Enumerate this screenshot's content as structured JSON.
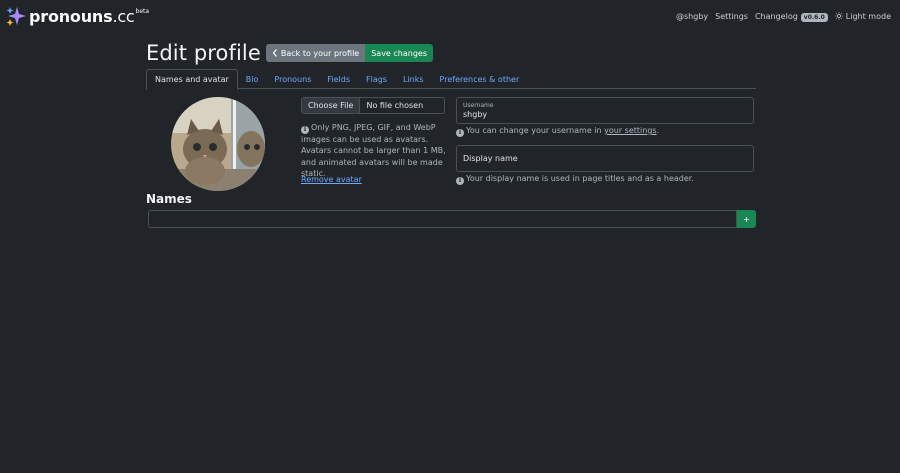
{
  "navbar": {
    "brand_name": "pronouns",
    "brand_tld": ".cc",
    "brand_badge": "beta",
    "user_link": "@shgby",
    "settings_link": "Settings",
    "changelog_link": "Changelog",
    "version_badge": "v0.6.0",
    "theme_toggle": "Light mode"
  },
  "header": {
    "title": "Edit profile",
    "back_button": "Back to your profile",
    "save_button": "Save changes"
  },
  "tabs": [
    {
      "label": "Names and avatar",
      "active": true
    },
    {
      "label": "Bio"
    },
    {
      "label": "Pronouns"
    },
    {
      "label": "Fields"
    },
    {
      "label": "Flags"
    },
    {
      "label": "Links"
    },
    {
      "label": "Preferences & other"
    }
  ],
  "avatar_section": {
    "file_button": "Choose File",
    "file_status": "No file chosen",
    "help_text": "Only PNG, JPEG, GIF, and WebP images can be used as avatars. Avatars cannot be larger than 1 MB, and animated avatars will be made static.",
    "remove_link": "Remove avatar"
  },
  "username": {
    "label": "Username",
    "value": "shgby",
    "help_prefix": "You can change your username in ",
    "help_link": "your settings",
    "help_suffix": "."
  },
  "display_name": {
    "placeholder": "Display name",
    "value": "",
    "help": "Your display name is used in page titles and as a header."
  },
  "names": {
    "title": "Names",
    "input_value": "",
    "add_button": "+"
  },
  "colors": {
    "background": "#212529",
    "link": "#6ea8fe",
    "success": "#198754",
    "secondary": "#6c757d"
  }
}
